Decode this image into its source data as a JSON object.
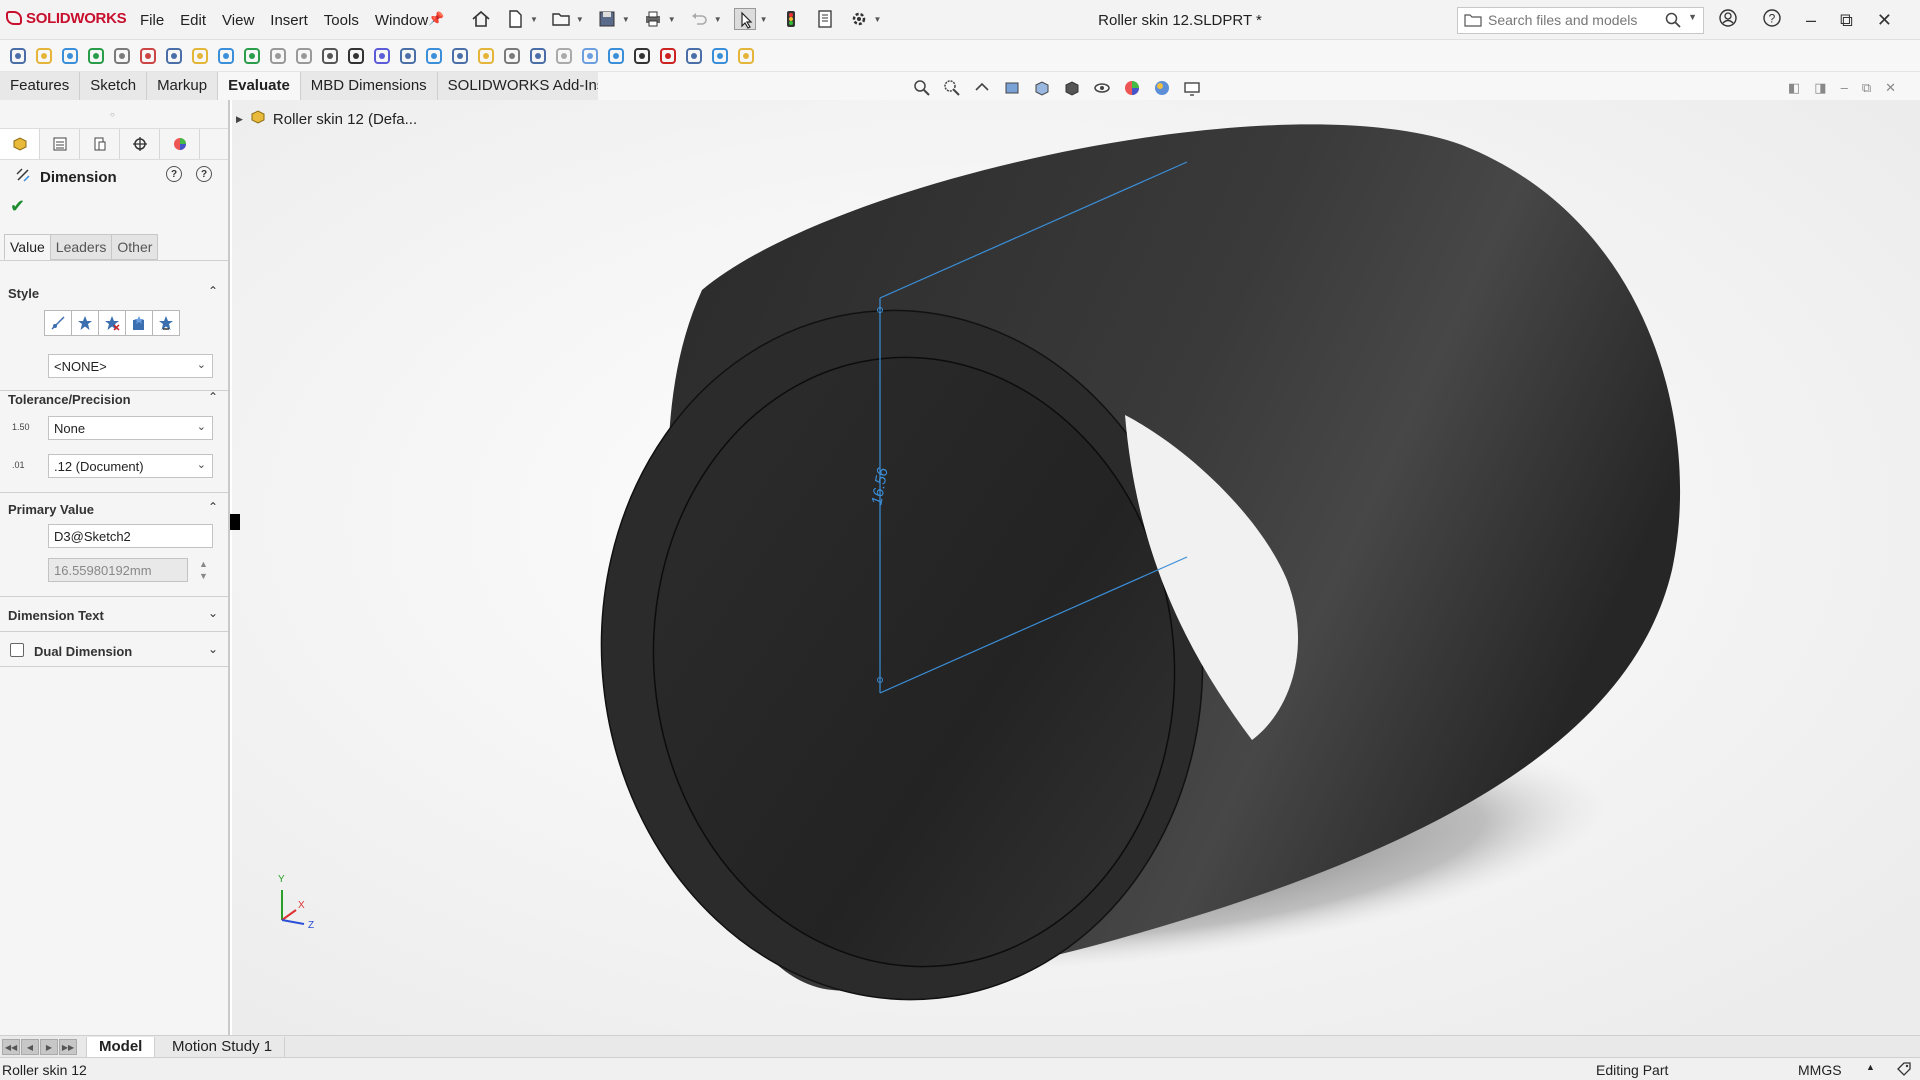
{
  "app": {
    "logo_text": "SOLIDWORKS",
    "document_title": "Roller skin 12.SLDPRT *",
    "menu": [
      "File",
      "Edit",
      "View",
      "Insert",
      "Tools",
      "Window"
    ],
    "search_placeholder": "Search files and models",
    "brand_color": "#c8102e"
  },
  "command_tabs": [
    {
      "label": "Features",
      "active": false
    },
    {
      "label": "Sketch",
      "active": false
    },
    {
      "label": "Markup",
      "active": false
    },
    {
      "label": "Evaluate",
      "active": true
    },
    {
      "label": "MBD Dimensions",
      "active": false
    },
    {
      "label": "SOLIDWORKS Add-Ins",
      "active": false
    }
  ],
  "property_manager": {
    "title": "Dimension",
    "subtabs": [
      "Value",
      "Leaders",
      "Other"
    ],
    "active_subtab": "Value",
    "style": {
      "heading": "Style",
      "favorite": "<NONE>"
    },
    "tolerance": {
      "heading": "Tolerance/Precision",
      "tolerance_icon_text": "1.50",
      "tolerance_type": "None",
      "precision_icon_text": ".01",
      "precision": ".12 (Document)"
    },
    "primary_value": {
      "heading": "Primary Value",
      "name": "D3@Sketch2",
      "value": "16.55980192mm"
    },
    "dimension_text": {
      "heading": "Dimension Text"
    },
    "dual_dimension": {
      "heading": "Dual Dimension",
      "checked": false
    }
  },
  "feature_tree": {
    "root": "Roller skin 12  (Defa..."
  },
  "viewport": {
    "dimension_label": "16.56",
    "dimension_color": "#3b8fd9",
    "model_color": "#2e2e2e",
    "triad": {
      "y": "Y",
      "x": "X",
      "z": "Z"
    }
  },
  "bottom_tabs": [
    {
      "label": "Model",
      "active": true
    },
    {
      "label": "Motion Study 1",
      "active": false
    }
  ],
  "status": {
    "part_name": "Roller skin 12",
    "mode": "Editing Part",
    "units": "MMGS"
  }
}
